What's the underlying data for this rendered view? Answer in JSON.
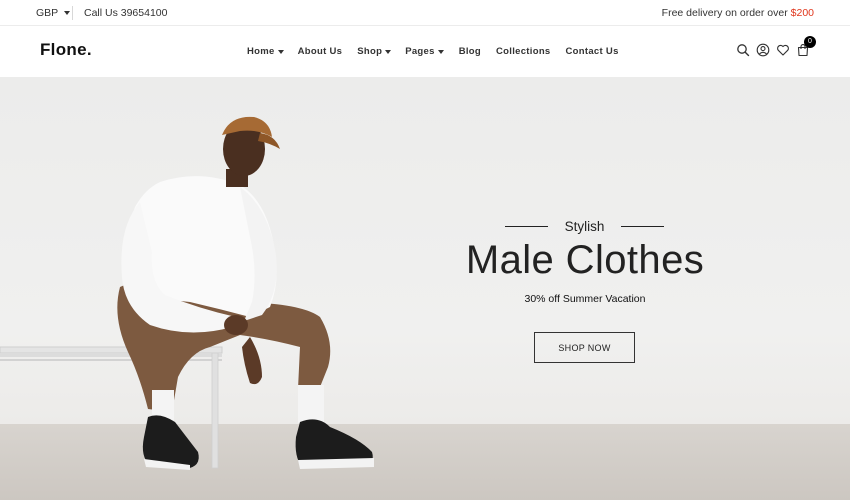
{
  "topbar": {
    "currency": "GBP",
    "phone": "Call Us 39654100",
    "delivery_text": "Free delivery on order over",
    "delivery_amount": "$200"
  },
  "header": {
    "logo": "Flone.",
    "nav": [
      {
        "label": "Home"
      },
      {
        "label": "About Us"
      },
      {
        "label": "Shop"
      },
      {
        "label": "Pages"
      },
      {
        "label": "Blog"
      },
      {
        "label": "Collections"
      },
      {
        "label": "Contact Us"
      }
    ],
    "cart_count": "0"
  },
  "hero": {
    "kicker": "Stylish",
    "title": "Male Clothes",
    "subtitle": "30% off Summer Vacation",
    "cta": "SHOP NOW"
  },
  "colors": {
    "accent": "#e0361c",
    "text": "#222222",
    "hero_bg": "#ececeb"
  }
}
